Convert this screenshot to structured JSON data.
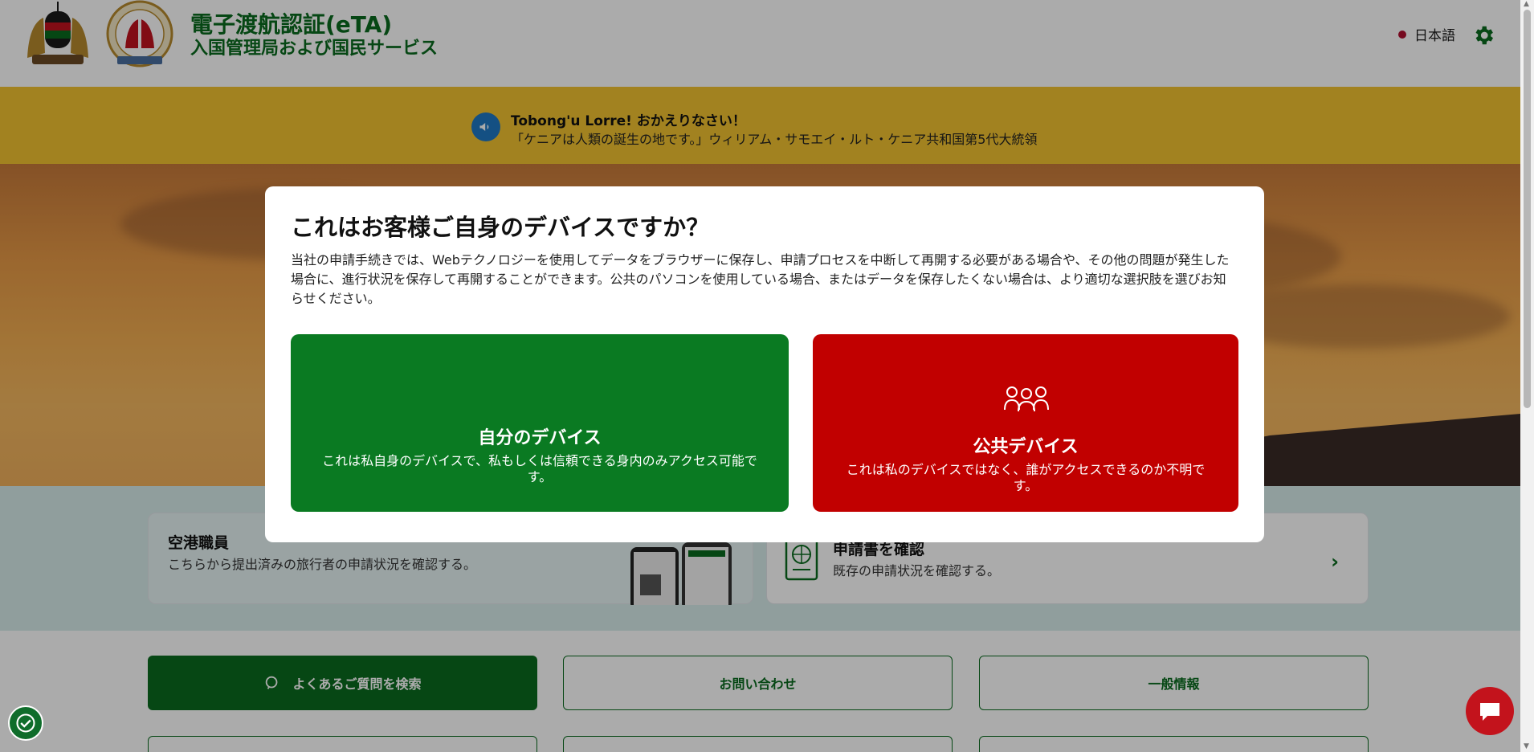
{
  "header": {
    "title": "電子渡航認証(eTA)",
    "subtitle": "入国管理局および国民サービス",
    "language": "日本語"
  },
  "banner": {
    "greeting": "Tobong'u Lorre! おかえりなさい！",
    "quote": "「ケニアは人類の誕生の地です。」ウィリアム・サモエイ・ルト・ケニア共和国第5代大統領"
  },
  "cards": {
    "staff": {
      "title": "空港職員",
      "subtitle": "こちらから提出済みの旅行者の申請状況を確認する。"
    },
    "check": {
      "title": "申請書を確認",
      "subtitle": "既存の申請状況を確認する。"
    }
  },
  "buttons": {
    "search_faq": "よくあるご質問を検索",
    "contact": "お問い合わせ",
    "general_info": "一般情報"
  },
  "modal": {
    "title": "これはお客様ご自身のデバイスですか？",
    "description": "当社の申請手続きでは、Webテクノロジーを使用してデータをブラウザーに保存し、申請プロセスを中断して再開する必要がある場合や、その他の問題が発生した場合に、進行状況を保存して再開することができます。公共のパソコンを使用している場合、またはデータを保存したくない場合は、より適切な選択肢を選びお知らせください。",
    "own_device": {
      "title": "自分のデバイス",
      "description": "これは私自身のデバイスで、私もしくは信頼できる身内のみアクセス可能です。"
    },
    "public_device": {
      "title": "公共デバイス",
      "description": "これは私のデバイスではなく、誰がアクセスできるのか不明です。"
    }
  },
  "colors": {
    "brand_green": "#0a6b1f",
    "own_device_green": "#0a7a22",
    "public_device_red": "#c10000",
    "banner_yellow": "#f2c230",
    "chat_red": "#c3131c"
  },
  "icons": [
    "coat-of-arms-emblem",
    "immigration-emblem",
    "gear-icon",
    "megaphone-icon",
    "search-icon",
    "document-icon",
    "chevron-right-icon",
    "people-icon",
    "accessibility-icon",
    "chat-icon"
  ]
}
